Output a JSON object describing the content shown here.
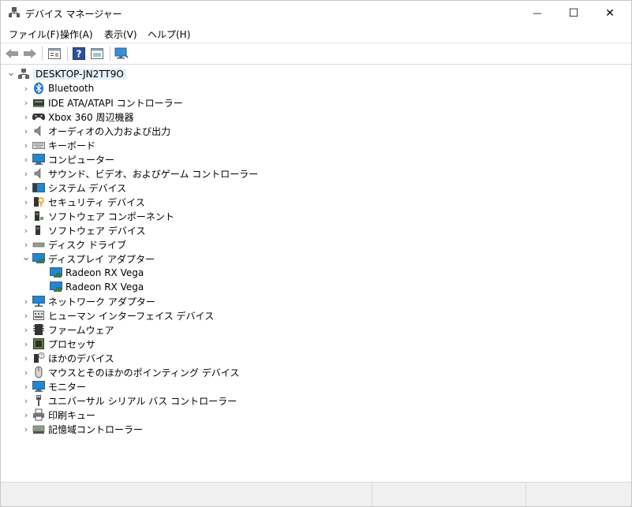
{
  "window": {
    "title": "デバイス マネージャー",
    "minimize_glyph": "—",
    "maximize_glyph": "☐",
    "close_glyph": "✕"
  },
  "menu": {
    "file": "ファイル(F)",
    "action": "操作(A)",
    "view": "表示(V)",
    "help": "ヘルプ(H)"
  },
  "toolbar": {
    "icons": [
      "back-arrow-icon",
      "forward-arrow-icon",
      "properties-icon",
      "help-icon",
      "update-driver-icon",
      "monitor-network-icon"
    ]
  },
  "tree": {
    "root": "DESKTOP-JN2TT9O",
    "expand_glyph": "›",
    "collapse_glyph": "⌄",
    "items": [
      {
        "label": "Bluetooth",
        "icon": "bluetooth-icon"
      },
      {
        "label": "IDE ATA/ATAPI コントローラー",
        "icon": "ide-controller-icon"
      },
      {
        "label": "Xbox 360 周辺機器",
        "icon": "gamepad-icon"
      },
      {
        "label": "オーディオの入力および出力",
        "icon": "speaker-icon"
      },
      {
        "label": "キーボード",
        "icon": "keyboard-icon"
      },
      {
        "label": "コンピューター",
        "icon": "computer-icon"
      },
      {
        "label": "サウンド、ビデオ、およびゲーム コントローラー",
        "icon": "sound-icon"
      },
      {
        "label": "システム デバイス",
        "icon": "system-device-icon"
      },
      {
        "label": "セキュリティ デバイス",
        "icon": "security-device-icon"
      },
      {
        "label": "ソフトウェア コンポーネント",
        "icon": "software-component-icon"
      },
      {
        "label": "ソフトウェア デバイス",
        "icon": "software-device-icon"
      },
      {
        "label": "ディスク ドライブ",
        "icon": "disk-drive-icon"
      },
      {
        "label": "ディスプレイ アダプター",
        "icon": "display-adapter-icon",
        "expanded": true
      },
      {
        "label": "Radeon RX Vega",
        "icon": "display-adapter-icon",
        "child": true
      },
      {
        "label": "Radeon RX Vega",
        "icon": "display-adapter-icon",
        "child": true
      },
      {
        "label": "ネットワーク アダプター",
        "icon": "network-adapter-icon"
      },
      {
        "label": "ヒューマン インターフェイス デバイス",
        "icon": "hid-icon"
      },
      {
        "label": "ファームウェア",
        "icon": "firmware-icon"
      },
      {
        "label": "プロセッサ",
        "icon": "processor-icon"
      },
      {
        "label": "ほかのデバイス",
        "icon": "other-device-icon"
      },
      {
        "label": "マウスとそのほかのポインティング デバイス",
        "icon": "mouse-icon"
      },
      {
        "label": "モニター",
        "icon": "monitor-icon"
      },
      {
        "label": "ユニバーサル シリアル バス コントローラー",
        "icon": "usb-icon"
      },
      {
        "label": "印刷キュー",
        "icon": "printer-icon"
      },
      {
        "label": "記憶域コントローラー",
        "icon": "storage-controller-icon"
      }
    ]
  },
  "colors": {
    "selection": "#e5f1fb",
    "accent_blue": "#1e7bd6",
    "status_bg": "#f0f0f0"
  }
}
